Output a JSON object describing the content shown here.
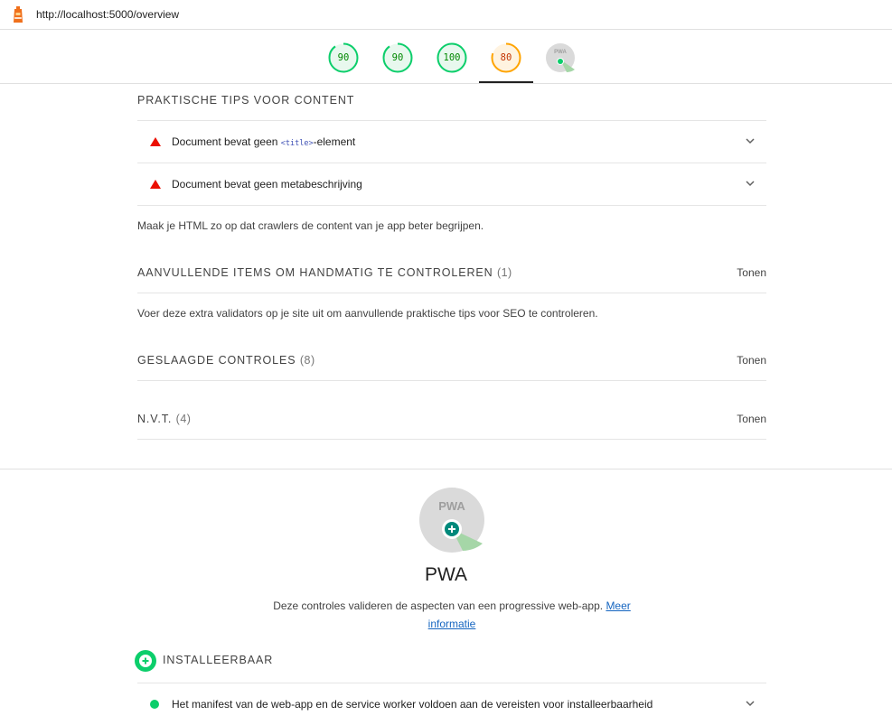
{
  "address_bar": {
    "url": "http://localhost:5000/overview"
  },
  "gauges": [
    {
      "label": "90",
      "score": 90,
      "color": "#0cce6b"
    },
    {
      "label": "90",
      "score": 90,
      "color": "#0cce6b"
    },
    {
      "label": "100",
      "score": 100,
      "color": "#0cce6b"
    },
    {
      "label": "80",
      "score": 80,
      "color": "#ffa400",
      "active": true
    },
    {
      "label": "PWA",
      "type": "pwa-badge"
    }
  ],
  "seo": {
    "content_group": {
      "title": "PRAKTISCHE TIPS VOOR CONTENT",
      "audits": [
        {
          "prefix": "Document bevat geen ",
          "code": "<title>",
          "suffix": "-element",
          "status": "fail"
        },
        {
          "text": "Document bevat geen metabeschrijving",
          "status": "fail"
        }
      ],
      "description": "Maak je HTML zo op dat crawlers de content van je app beter begrijpen."
    },
    "manual": {
      "title": "AANVULLENDE ITEMS OM HANDMATIG TE CONTROLEREN",
      "count": "(1)",
      "toggle": "Tonen",
      "description": "Voer deze extra validators op je site uit om aanvullende praktische tips voor SEO te controleren."
    },
    "passed": {
      "title": "GESLAAGDE CONTROLES",
      "count": "(8)",
      "toggle": "Tonen"
    },
    "na": {
      "title": "N.V.T.",
      "count": "(4)",
      "toggle": "Tonen"
    }
  },
  "pwa": {
    "badge_text": "PWA",
    "title": "PWA",
    "description": "Deze controles valideren de aspecten van een progressive web-app.",
    "link_line1": "Meer",
    "link_line2": "informatie",
    "installable": {
      "title": "INSTALLEERBAAR",
      "audits": [
        {
          "text": "Het manifest van de web-app en de service worker voldoen aan de vereisten voor installeerbaarheid",
          "status": "pass"
        }
      ]
    }
  },
  "colors": {
    "pass": "#0cce6b",
    "average": "#ffa400",
    "fail": "#eb0f00",
    "link": "#1565c0"
  }
}
